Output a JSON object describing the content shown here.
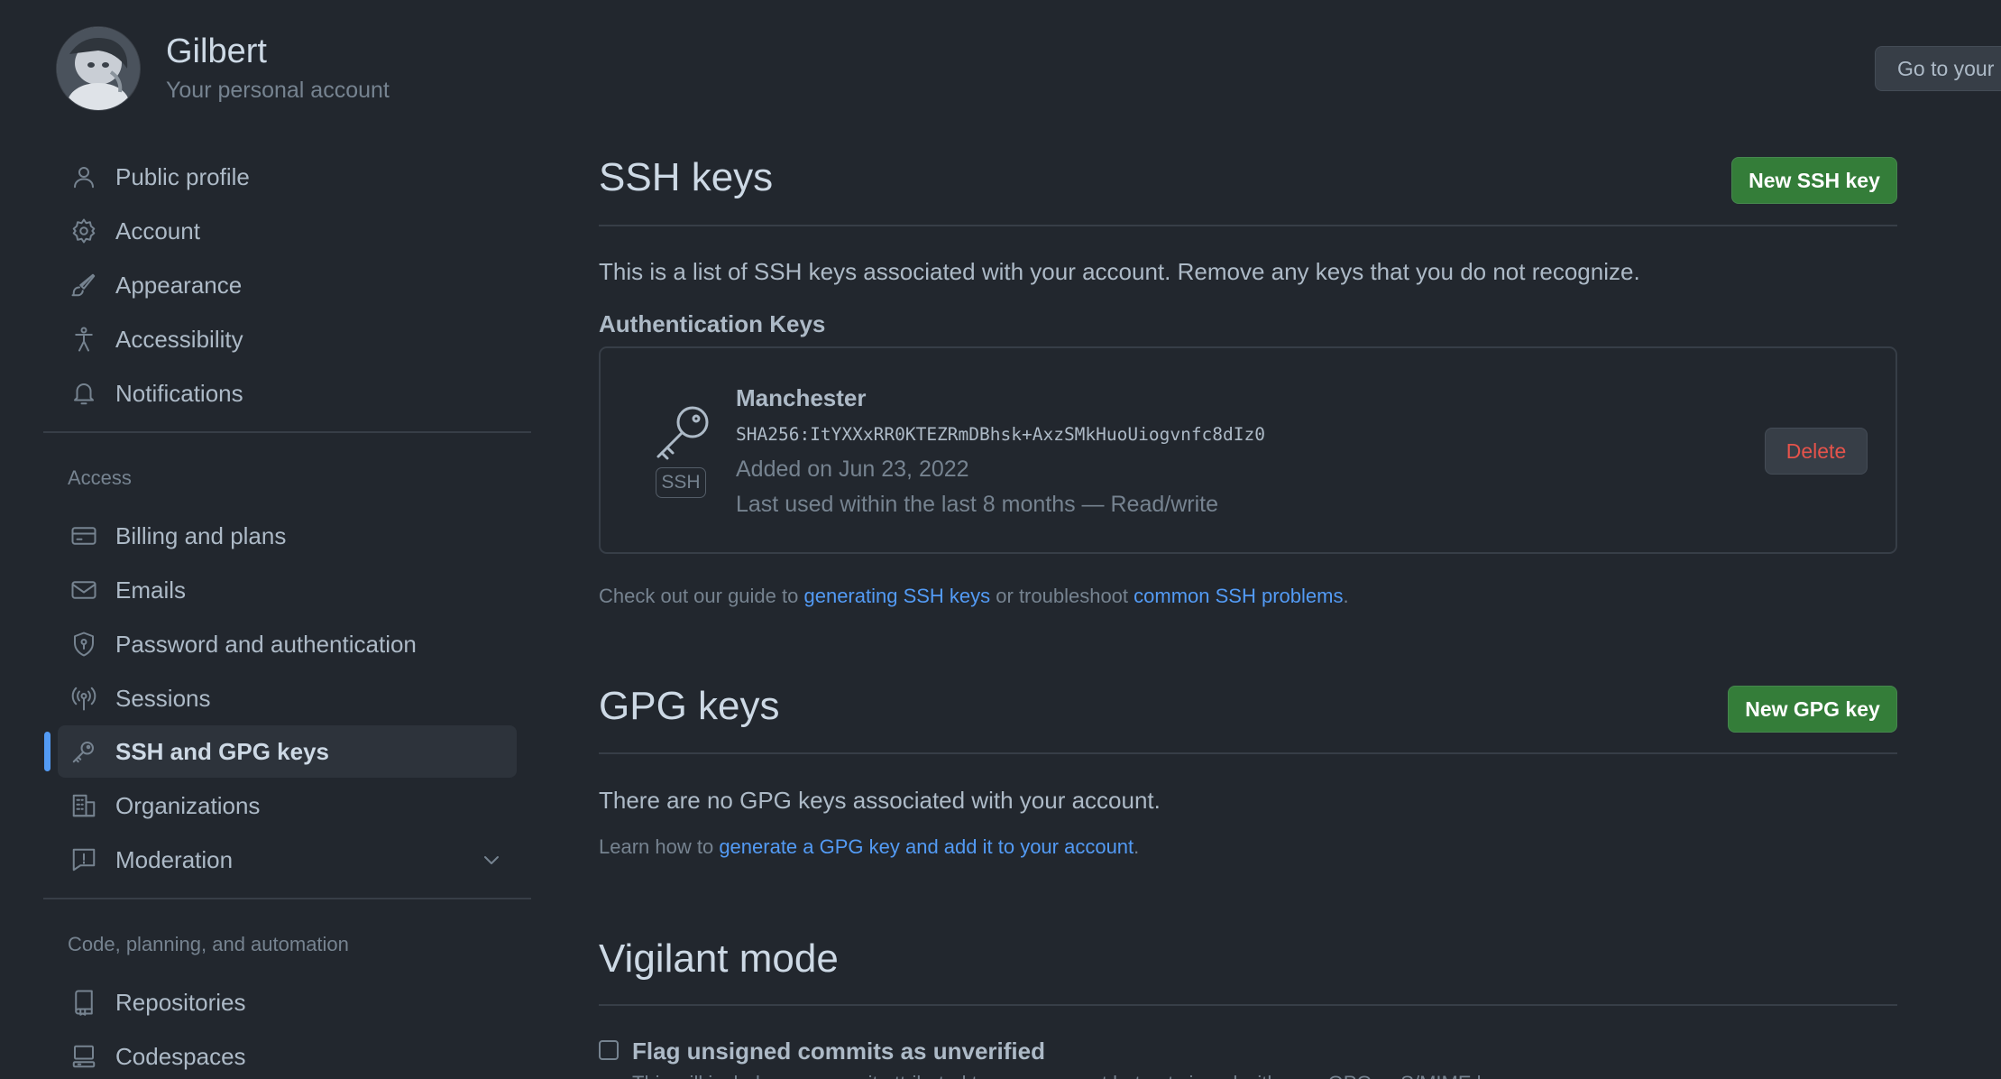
{
  "account": {
    "name": "Gilbert",
    "subtitle": "Your personal account",
    "goto_label": "Go to your"
  },
  "sidebar": {
    "items": [
      {
        "label": "Public profile",
        "icon": "person-icon"
      },
      {
        "label": "Account",
        "icon": "gear-icon"
      },
      {
        "label": "Appearance",
        "icon": "paintbrush-icon"
      },
      {
        "label": "Accessibility",
        "icon": "accessibility-icon"
      },
      {
        "label": "Notifications",
        "icon": "bell-icon"
      }
    ],
    "access_label": "Access",
    "access_items": [
      {
        "label": "Billing and plans",
        "icon": "credit-card-icon"
      },
      {
        "label": "Emails",
        "icon": "mail-icon"
      },
      {
        "label": "Password and authentication",
        "icon": "shield-icon"
      },
      {
        "label": "Sessions",
        "icon": "broadcast-icon"
      },
      {
        "label": "SSH and GPG keys",
        "icon": "key-icon",
        "active": true
      },
      {
        "label": "Organizations",
        "icon": "organization-icon"
      },
      {
        "label": "Moderation",
        "icon": "report-icon"
      }
    ],
    "code_label": "Code, planning, and automation",
    "code_items": [
      {
        "label": "Repositories",
        "icon": "repo-icon"
      },
      {
        "label": "Codespaces",
        "icon": "codespaces-icon"
      }
    ]
  },
  "ssh": {
    "title": "SSH keys",
    "new_button": "New SSH key",
    "description": "This is a list of SSH keys associated with your account. Remove any keys that you do not recognize.",
    "auth_heading": "Authentication Keys",
    "key": {
      "badge": "SSH",
      "name": "Manchester",
      "fingerprint": "SHA256:ItYXXxRR0KTEZRmDBhsk+AxzSMkHuoUiogvnfc8dIz0",
      "added": "Added on Jun 23, 2022",
      "last_used": "Last used within the last 8 months — Read/write",
      "delete_label": "Delete"
    },
    "guide_prefix": "Check out our guide to ",
    "guide_link1": "generating SSH keys",
    "guide_middle": " or troubleshoot ",
    "guide_link2": "common SSH problems",
    "guide_suffix": "."
  },
  "gpg": {
    "title": "GPG keys",
    "new_button": "New GPG key",
    "empty_text": "There are no GPG keys associated with your account.",
    "learn_prefix": "Learn how to ",
    "learn_link": "generate a GPG key and add it to your account",
    "learn_suffix": "."
  },
  "vigilant": {
    "title": "Vigilant mode",
    "checkbox_label": "Flag unsigned commits as unverified",
    "checked": false,
    "cutoff_text": "This will include any commit attributed to your account but not signed with your GPG or S/MIME key."
  },
  "colors": {
    "background": "#22272e",
    "accent": "#539bf5",
    "primary_button": "#347d39",
    "danger": "#e5534b"
  }
}
